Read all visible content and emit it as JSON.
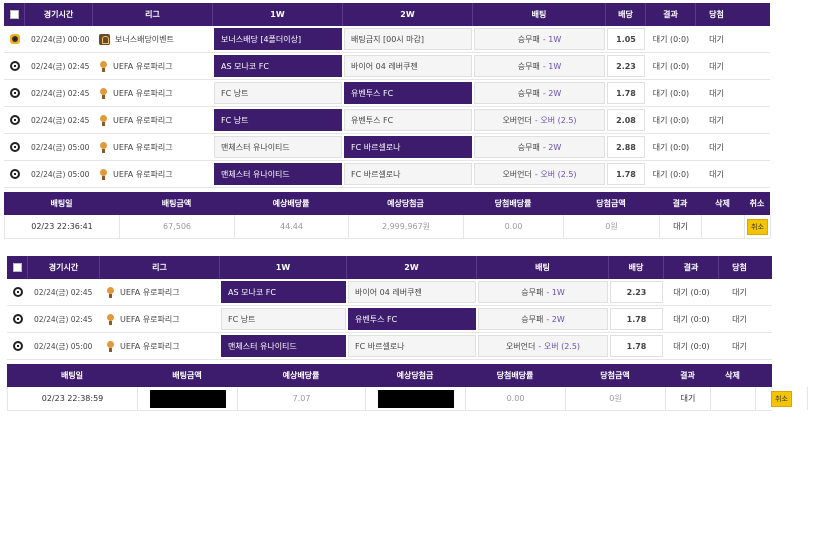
{
  "headers": {
    "time": "경기시간",
    "league": "리그",
    "home": "1W",
    "away": "2W",
    "bet": "배팅",
    "odds": "배당",
    "result": "결과",
    "win": "당첨"
  },
  "summary_headers": {
    "bet_date": "배팅일",
    "bet_amount": "배팅금액",
    "expected_odds": "예상배당률",
    "expected_win": "예상당첨금",
    "win_odds": "당첨배당률",
    "win_amount": "당첨금액",
    "result": "결과",
    "delete": "삭제",
    "cancel": "취소"
  },
  "slip1": {
    "rows": [
      {
        "time": "02/24(금) 00:00",
        "league": "보너스배당이벤트",
        "league_icon": "bonus-event-icon",
        "ball": "bonus-icon",
        "home": "보너스배당 [4폴더이상]",
        "away": "배팅금지 [00시 마감]",
        "pick_side": "home",
        "bet_label": "승무패",
        "bet_pick": "1W",
        "odds": "1.05",
        "result": "대기 (0:0)",
        "win": "대기"
      },
      {
        "time": "02/24(금) 02:45",
        "league": "UEFA 유로파리그",
        "league_icon": "uefa-icon",
        "ball": "soccer-ball-icon",
        "home": "AS 모나코 FC",
        "away": "바이어 04 레버쿠젠",
        "pick_side": "home",
        "bet_label": "승무패",
        "bet_pick": "1W",
        "odds": "2.23",
        "result": "대기 (0:0)",
        "win": "대기"
      },
      {
        "time": "02/24(금) 02:45",
        "league": "UEFA 유로파리그",
        "league_icon": "uefa-icon",
        "ball": "soccer-ball-icon",
        "home": "FC 낭트",
        "away": "유벤투스 FC",
        "pick_side": "away",
        "bet_label": "승무패",
        "bet_pick": "2W",
        "odds": "1.78",
        "result": "대기 (0:0)",
        "win": "대기"
      },
      {
        "time": "02/24(금) 02:45",
        "league": "UEFA 유로파리그",
        "league_icon": "uefa-icon",
        "ball": "soccer-ball-icon",
        "home": "FC 낭트",
        "away": "유벤투스 FC",
        "pick_side": "home",
        "bet_label": "오버언더",
        "bet_pick": "오버 (2.5)",
        "odds": "2.08",
        "result": "대기 (0:0)",
        "win": "대기"
      },
      {
        "time": "02/24(금) 05:00",
        "league": "UEFA 유로파리그",
        "league_icon": "uefa-icon",
        "ball": "soccer-ball-icon",
        "home": "맨체스터 유나이티드",
        "away": "FC 바르셀로나",
        "pick_side": "away",
        "bet_label": "승무패",
        "bet_pick": "2W",
        "odds": "2.88",
        "result": "대기 (0:0)",
        "win": "대기"
      },
      {
        "time": "02/24(금) 05:00",
        "league": "UEFA 유로파리그",
        "league_icon": "uefa-icon",
        "ball": "soccer-ball-icon",
        "home": "맨체스터 유나이티드",
        "away": "FC 바르셀로나",
        "pick_side": "home",
        "bet_label": "오버언더",
        "bet_pick": "오버 (2.5)",
        "odds": "1.78",
        "result": "대기 (0:0)",
        "win": "대기"
      }
    ],
    "summary": {
      "bet_date": "02/23 22:36:41",
      "bet_amount": "67,506",
      "expected_odds": "44.44",
      "expected_win": "2,999,967원",
      "win_odds": "0.00",
      "win_amount": "0원",
      "result": "대기",
      "delete": "",
      "cancel": "취소"
    }
  },
  "slip2": {
    "rows": [
      {
        "time": "02/24(금) 02:45",
        "league": "UEFA 유로파리그",
        "league_icon": "uefa-icon",
        "ball": "soccer-ball-icon",
        "home": "AS 모나코 FC",
        "away": "바이어 04 레버쿠젠",
        "pick_side": "home",
        "bet_label": "승무패",
        "bet_pick": "1W",
        "odds": "2.23",
        "result": "대기 (0:0)",
        "win": "대기"
      },
      {
        "time": "02/24(금) 02:45",
        "league": "UEFA 유로파리그",
        "league_icon": "uefa-icon",
        "ball": "soccer-ball-icon",
        "home": "FC 낭트",
        "away": "유벤투스 FC",
        "pick_side": "away",
        "bet_label": "승무패",
        "bet_pick": "2W",
        "odds": "1.78",
        "result": "대기 (0:0)",
        "win": "대기"
      },
      {
        "time": "02/24(금) 05:00",
        "league": "UEFA 유로파리그",
        "league_icon": "uefa-icon",
        "ball": "soccer-ball-icon",
        "home": "맨체스터 유나이티드",
        "away": "FC 바르셀로나",
        "pick_side": "home",
        "bet_label": "오버언더",
        "bet_pick": "오버 (2.5)",
        "odds": "1.78",
        "result": "대기 (0:0)",
        "win": "대기"
      }
    ],
    "summary": {
      "bet_date": "02/23 22:38:59",
      "bet_amount": "",
      "expected_odds": "7.07",
      "expected_win": "",
      "win_odds": "0.00",
      "win_amount": "0원",
      "result": "대기",
      "delete": "",
      "cancel": "취소"
    }
  },
  "colors": {
    "header_bg": "#3d1c6e",
    "selected_bg": "#3d1c6e",
    "odds_text": "#6a4fb3",
    "cancel_btn": "#f5c400"
  }
}
